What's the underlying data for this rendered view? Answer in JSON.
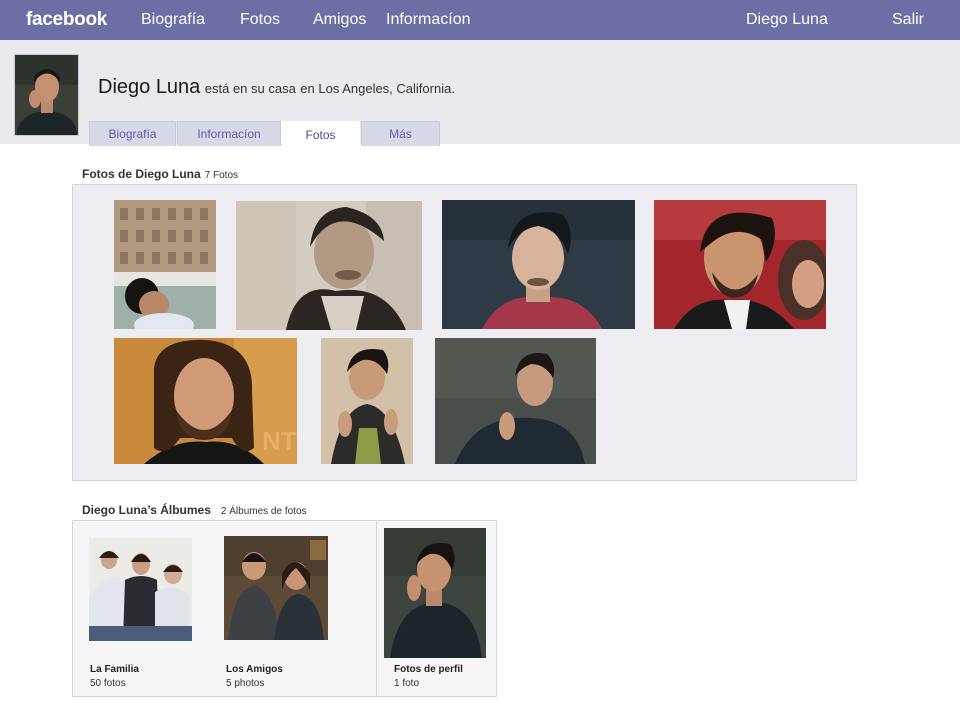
{
  "topbar": {
    "logo": "facebook",
    "nav": [
      "Biografía",
      "Fotos",
      "Amigos",
      "Informacíon"
    ],
    "user": "Diego Luna",
    "logout": "Salir",
    "color": "#6d6ea3"
  },
  "profile": {
    "name": "Diego Luna",
    "status": "está en su casa",
    "location": "en Los Angeles, California."
  },
  "tabs": [
    "Biografía",
    "Informacíon",
    "Fotos",
    "Más"
  ],
  "photos_section": {
    "title": "Fotos de Diego Luna",
    "count": "7 Fotos"
  },
  "albums_section": {
    "title": "Diego Luna’s Álbumes",
    "count": "2 Álbumes de fotos",
    "albums": [
      {
        "name": "La Familia",
        "count": "50 fotos"
      },
      {
        "name": "Los Amigos",
        "count": "5 photos"
      },
      {
        "name": "Fotos de perfil",
        "count": "1 foto"
      }
    ]
  }
}
